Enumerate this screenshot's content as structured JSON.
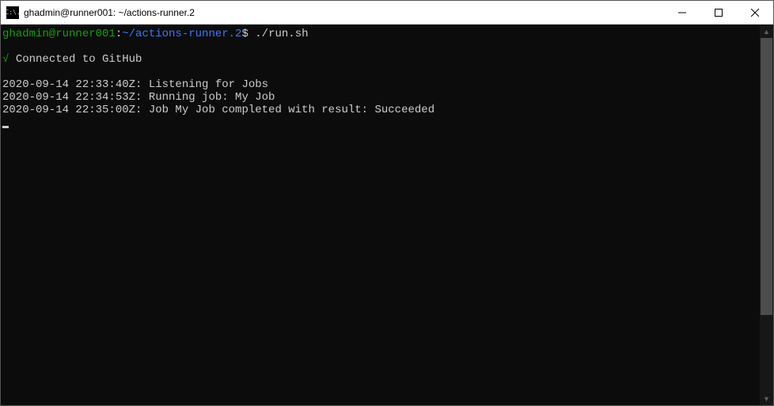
{
  "window": {
    "icon_glyph": "C:\\.",
    "title": "ghadmin@runner001: ~/actions-runner.2"
  },
  "prompt": {
    "user_host": "ghadmin@runner001",
    "colon": ":",
    "path": "~/actions-runner.2",
    "dollar": "$",
    "command": "./run.sh"
  },
  "status": {
    "check": "√",
    "text": "Connected to GitHub"
  },
  "logs": [
    "2020-09-14 22:33:40Z: Listening for Jobs",
    "2020-09-14 22:34:53Z: Running job: My Job",
    "2020-09-14 22:35:00Z: Job My Job completed with result: Succeeded"
  ]
}
